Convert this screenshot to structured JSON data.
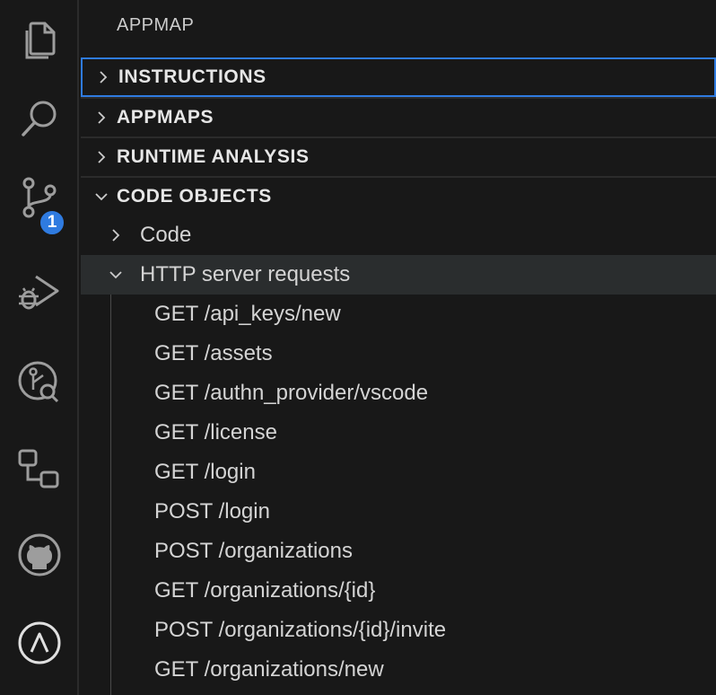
{
  "activity_bar": {
    "items": [
      {
        "icon": "explorer-icon"
      },
      {
        "icon": "search-icon"
      },
      {
        "icon": "source-control-icon",
        "badge": "1"
      },
      {
        "icon": "run-debug-icon"
      },
      {
        "icon": "appmap-analysis-icon"
      },
      {
        "icon": "remote-explorer-icon"
      },
      {
        "icon": "github-icon"
      },
      {
        "icon": "appmap-icon"
      }
    ]
  },
  "panel": {
    "title": "APPMAP",
    "sections": [
      {
        "label": "INSTRUCTIONS",
        "expanded": false
      },
      {
        "label": "APPMAPS",
        "expanded": false
      },
      {
        "label": "RUNTIME ANALYSIS",
        "expanded": false
      },
      {
        "label": "CODE OBJECTS",
        "expanded": true
      }
    ],
    "tree": {
      "code": {
        "label": "Code",
        "expanded": false
      },
      "http": {
        "label": "HTTP server requests",
        "expanded": true
      },
      "requests": [
        "GET /api_keys/new",
        "GET /assets",
        "GET /authn_provider/vscode",
        "GET /license",
        "GET /login",
        "POST /login",
        "POST /organizations",
        "GET /organizations/{id}",
        "POST /organizations/{id}/invite",
        "GET /organizations/new"
      ]
    }
  },
  "colors": {
    "background": "#181818",
    "accent": "#2f7be0",
    "selected_row": "#2a2d2e",
    "icon": "#9d9d9d"
  }
}
